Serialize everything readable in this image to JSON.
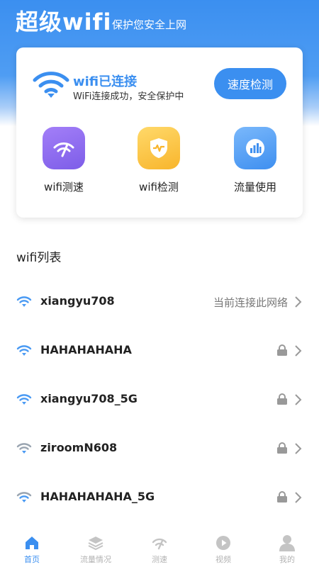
{
  "header": {
    "title": "超级wifi",
    "subtitle": "保护您安全上网"
  },
  "connection": {
    "title": "wifi已连接",
    "subtitle": "WiFi连接成功，安全保护中",
    "speed_button": "速度检测"
  },
  "features": [
    {
      "label": "wifi测速",
      "icon": "speedometer-icon"
    },
    {
      "label": "wifi检测",
      "icon": "shield-heartbeat-icon"
    },
    {
      "label": "流量使用",
      "icon": "bar-chart-icon"
    }
  ],
  "wifi_list": {
    "heading": "wifi列表",
    "items": [
      {
        "name": "xiangyu708",
        "status": "当前连接此网络",
        "locked": false,
        "signal": "blue"
      },
      {
        "name": "HAHAHAHAHA",
        "status": "",
        "locked": true,
        "signal": "blue"
      },
      {
        "name": "xiangyu708_5G",
        "status": "",
        "locked": true,
        "signal": "blue"
      },
      {
        "name": "ziroomN608",
        "status": "",
        "locked": true,
        "signal": "gray"
      },
      {
        "name": "HAHAHAHAHA_5G",
        "status": "",
        "locked": true,
        "signal": "gray"
      }
    ]
  },
  "tabs": [
    {
      "label": "首页",
      "icon": "home-icon",
      "active": true
    },
    {
      "label": "流量情况",
      "icon": "layers-icon",
      "active": false
    },
    {
      "label": "测速",
      "icon": "speedometer-icon",
      "active": false
    },
    {
      "label": "视频",
      "icon": "play-icon",
      "active": false
    },
    {
      "label": "我的",
      "icon": "user-icon",
      "active": false
    }
  ],
  "colors": {
    "accent": "#3b8ff0",
    "signal_blue": "#4a9af3",
    "signal_gray": "#9aa5b1"
  }
}
